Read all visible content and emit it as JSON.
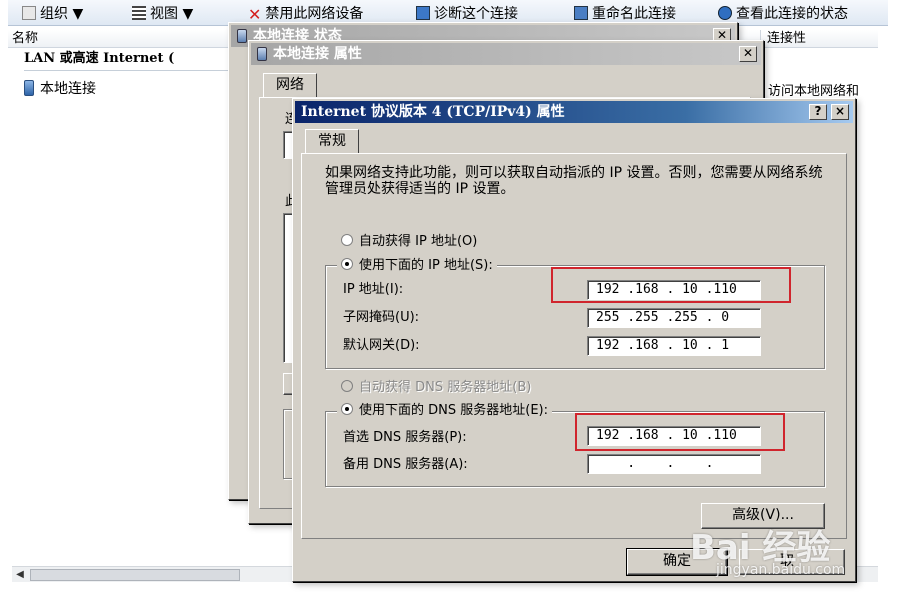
{
  "explorer": {
    "toolbar": {
      "organize": "组织 ▼",
      "views": "视图 ▼",
      "disable": "禁用此网络设备",
      "diagnose": "诊断这个连接",
      "rename": "重命名此连接",
      "status": "查看此连接的状态"
    },
    "columns": {
      "name": "名称",
      "right": "连接性"
    },
    "group_header": "LAN 或高速 Internet (",
    "item": "本地连接",
    "right_text": "访问本地网络和"
  },
  "status_window": {
    "title": "本地连接 状态"
  },
  "properties_window": {
    "title": "本地连接 属性",
    "tab": "网络",
    "partial_label_1": "连",
    "partial_label_2": "此"
  },
  "ipv4_dialog": {
    "title": "Internet 协议版本 4 (TCP/IPv4) 属性",
    "help_button": "?",
    "close_button": "×",
    "tab": "常规",
    "description": "如果网络支持此功能，则可以获取自动指派的 IP 设置。否则，您需要从网络系统管理员处获得适当的 IP 设置。",
    "auto_ip_label": "自动获得 IP 地址(O)",
    "manual_ip_label": "使用下面的 IP 地址(S):",
    "ip_address_label": "IP 地址(I):",
    "ip_address_value": "192 .168 . 10 .110",
    "subnet_label": "子网掩码(U):",
    "subnet_value": "255 .255 .255 . 0",
    "gateway_label": "默认网关(D):",
    "gateway_value": "192 .168 . 10 . 1",
    "auto_dns_label": "自动获得 DNS 服务器地址(B)",
    "manual_dns_label": "使用下面的 DNS 服务器地址(E):",
    "preferred_dns_label": "首选 DNS 服务器(P):",
    "preferred_dns_value": "192 .168 . 10 .110",
    "alternate_dns_label": "备用 DNS 服务器(A):",
    "alternate_dns_value": "    .    .    .",
    "advanced_button": "高级(V)...",
    "ok_button": "确定",
    "cancel_button_partial": "取"
  },
  "watermark": {
    "logo": "Bai 经验",
    "url": "jingyan.baidu.com"
  },
  "colors": {
    "highlight": "#d0252d",
    "titlebar_active": "#0a246a",
    "dialog_face": "#d4d0c8"
  }
}
